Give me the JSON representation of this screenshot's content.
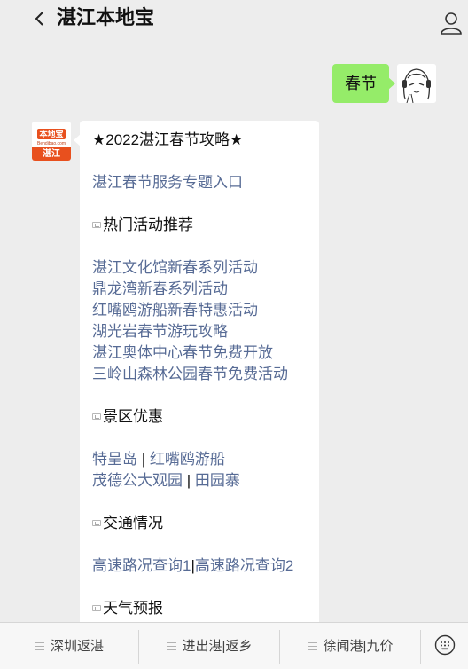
{
  "header": {
    "title": "湛江本地宝",
    "back_icon": "chevron-left-icon",
    "profile_icon": "user-icon"
  },
  "user_message": {
    "text": "春节"
  },
  "bot_avatar": {
    "logo": "本地宝",
    "site": "Bendibao.com",
    "city": "湛江"
  },
  "message": {
    "headline": "★2022湛江春节攻略★",
    "entry_link": "湛江春节服务专题入口",
    "sections": [
      {
        "title": "热门活动推荐"
      },
      {
        "title": "景区优惠"
      },
      {
        "title": "交通情况"
      },
      {
        "title": "天气预报"
      }
    ],
    "activities": [
      "湛江文化馆新春系列活动",
      "鼎龙湾新春系列活动",
      "红嘴鸥游船新春特惠活动",
      "湖光岩春节游玩攻略",
      "湛江奥体中心春节免费开放",
      "三岭山森林公园春节免费活动"
    ],
    "scenic": {
      "row1": [
        "特呈岛",
        "红嘴鸥游船"
      ],
      "row2": [
        "茂德公大观园",
        "田园寨"
      ]
    },
    "traffic": [
      "高速路况查询1",
      "高速路况查询2"
    ],
    "separator": "|"
  },
  "menu": {
    "items": [
      {
        "label": "深圳返湛"
      },
      {
        "label": "进出湛|返乡"
      },
      {
        "label": "徐闻港|九价"
      }
    ],
    "keyboard_icon": "keyboard-icon"
  },
  "colors": {
    "link": "#576b95",
    "user_bubble": "#95ec69",
    "brand": "#e8501e"
  }
}
